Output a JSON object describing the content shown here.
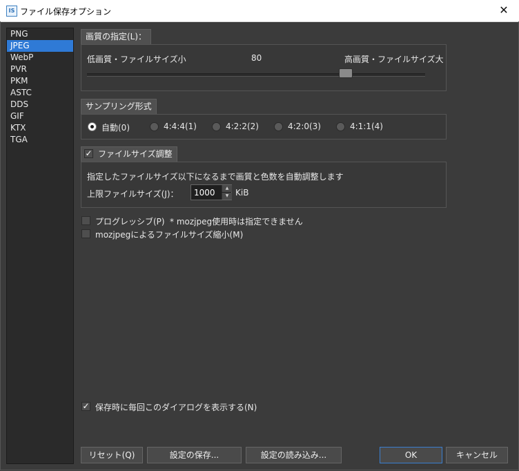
{
  "window": {
    "title": "ファイル保存オプション",
    "app_icon_text": "IS",
    "close_symbol": "✕"
  },
  "format_list": {
    "items": [
      "PNG",
      "JPEG",
      "WebP",
      "PVR",
      "PKM",
      "ASTC",
      "DDS",
      "GIF",
      "KTX",
      "TGA"
    ],
    "selected": "JPEG"
  },
  "quality": {
    "header": "画質の指定(L)：",
    "low_label": "低画質・ファイルサイズ小",
    "value": "80",
    "high_label": "高画質・ファイルサイズ大"
  },
  "sampling": {
    "header": "サンプリング形式",
    "options": [
      "自動(0)",
      "4:4:4(1)",
      "4:2:2(2)",
      "4:2:0(3)",
      "4:1:1(4)"
    ],
    "selected": "自動(0)"
  },
  "filesize_adjust": {
    "header": "ファイルサイズ調整",
    "checked": true,
    "description": "指定したファイルサイズ以下になるまで画質と色数を自動調整します",
    "limit_label": "上限ファイルサイズ(J)：",
    "limit_value": "1000",
    "unit": "KiB"
  },
  "progressive": {
    "label": "プログレッシブ(P)",
    "note": "* mozjpeg使用時は指定できません",
    "checked": false
  },
  "mozjpeg": {
    "label": "mozjpegによるファイルサイズ縮小(M)",
    "checked": false
  },
  "show_dialog": {
    "label": "保存時に毎回このダイアログを表示する(N)",
    "checked": true
  },
  "buttons": {
    "reset": "リセット(Q)",
    "save_settings": "設定の保存...",
    "load_settings": "設定の読み込み...",
    "ok": "OK",
    "cancel": "キャンセル"
  },
  "icons": {
    "check": "✓",
    "spin_up": "▲",
    "spin_down": "▼"
  },
  "colors": {
    "background": "#3b3b3b",
    "selection": "#2f7ad6",
    "header": "#505050"
  }
}
